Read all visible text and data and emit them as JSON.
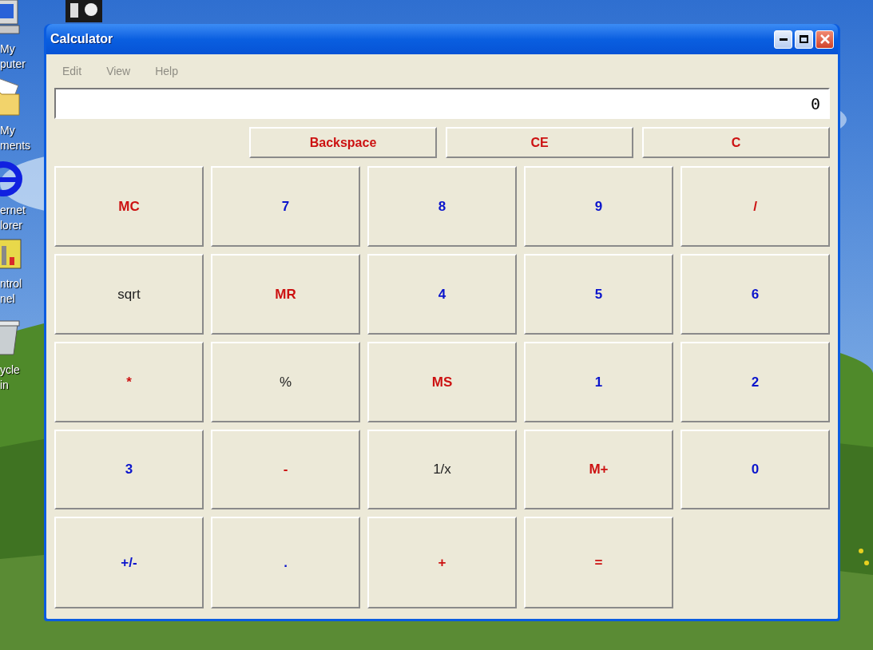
{
  "desktop_icons": [
    {
      "kind": "computer",
      "label": [
        "My",
        "puter"
      ]
    },
    {
      "kind": "folder",
      "label": [
        "My",
        "ments"
      ]
    },
    {
      "kind": "browser",
      "label": [
        "ernet",
        "lorer"
      ]
    },
    {
      "kind": "panel",
      "label": [
        "ntrol",
        "nel"
      ]
    },
    {
      "kind": "bin",
      "label": [
        "ycle",
        "in"
      ]
    }
  ],
  "window": {
    "title": "Calculator"
  },
  "menu": [
    "Edit",
    "View",
    "Help"
  ],
  "display": {
    "value": "0"
  },
  "top_buttons": [
    {
      "label": "Backspace",
      "kind": "red"
    },
    {
      "label": "CE",
      "kind": "red"
    },
    {
      "label": "C",
      "kind": "red"
    }
  ],
  "keys": [
    {
      "label": "MC",
      "kind": "red"
    },
    {
      "label": "7",
      "kind": "blue"
    },
    {
      "label": "8",
      "kind": "blue"
    },
    {
      "label": "9",
      "kind": "blue"
    },
    {
      "label": "/",
      "kind": "red"
    },
    {
      "label": "sqrt",
      "kind": "plain"
    },
    {
      "label": "MR",
      "kind": "red"
    },
    {
      "label": "4",
      "kind": "blue"
    },
    {
      "label": "5",
      "kind": "blue"
    },
    {
      "label": "6",
      "kind": "blue"
    },
    {
      "label": "*",
      "kind": "red"
    },
    {
      "label": "%",
      "kind": "plain"
    },
    {
      "label": "MS",
      "kind": "red"
    },
    {
      "label": "1",
      "kind": "blue"
    },
    {
      "label": "2",
      "kind": "blue"
    },
    {
      "label": "3",
      "kind": "blue"
    },
    {
      "label": "-",
      "kind": "red"
    },
    {
      "label": "1/x",
      "kind": "plain"
    },
    {
      "label": "M+",
      "kind": "red"
    },
    {
      "label": "0",
      "kind": "blue"
    },
    {
      "label": "+/-",
      "kind": "blue"
    },
    {
      "label": ".",
      "kind": "blue"
    },
    {
      "label": "+",
      "kind": "red"
    },
    {
      "label": "=",
      "kind": "red"
    }
  ]
}
